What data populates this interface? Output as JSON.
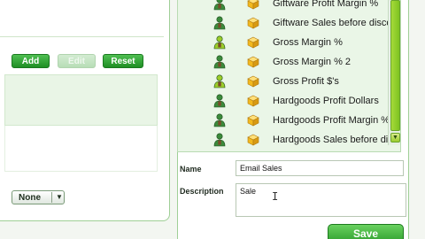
{
  "left_panel": {
    "buttons": {
      "add_label": "Add",
      "edit_label": "Edit",
      "reset_label": "Reset"
    },
    "select": {
      "value": "None",
      "arrow": "▼"
    }
  },
  "list": {
    "items": [
      {
        "label": "Giftware Profit Margin %",
        "person_color": "#3b8a3b"
      },
      {
        "label": "Giftware Sales before discount",
        "person_color": "#3b8a3b"
      },
      {
        "label": "Gross Margin %",
        "person_color": "#9bcc2a"
      },
      {
        "label": "Gross Margin % 2",
        "person_color": "#3b8a3b"
      },
      {
        "label": "Gross Profit $'s",
        "person_color": "#9bcc2a"
      },
      {
        "label": "Hardgoods Profit Dollars",
        "person_color": "#3b8a3b"
      },
      {
        "label": "Hardgoods Profit Margin %",
        "person_color": "#3b8a3b"
      },
      {
        "label": "Hardgoods Sales before discount",
        "person_color": "#3b8a3b"
      }
    ],
    "scroll_arrow": "▼"
  },
  "form": {
    "name_label": "Name",
    "name_value": "Email Sales",
    "description_label": "Description",
    "description_value": "Sale",
    "text_cursor": "I",
    "save_label": "Save"
  },
  "colors": {
    "accent_green": "#2a9a2a",
    "list_background": "#eaf6e7",
    "cube_color": "#f2b81e"
  }
}
